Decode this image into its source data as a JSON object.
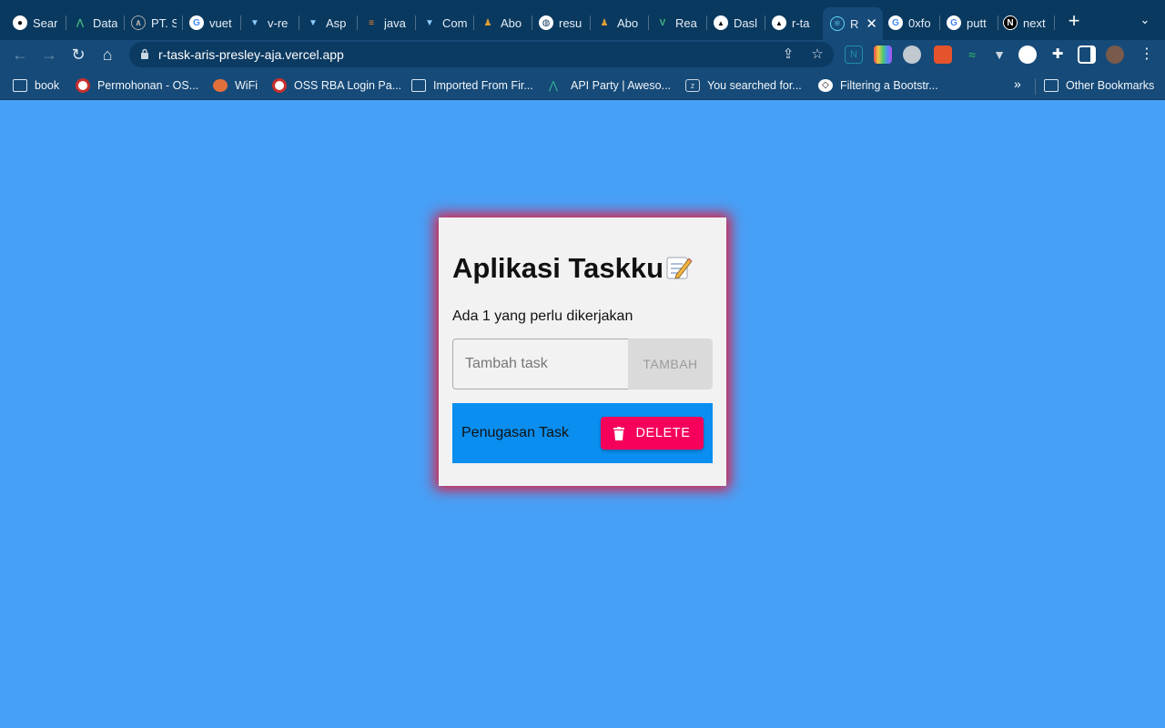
{
  "browser": {
    "tabs": [
      {
        "title": "Sear",
        "icon": "github-icon"
      },
      {
        "title": "Data",
        "icon": "vuetify-icon"
      },
      {
        "title": "PT. S",
        "icon": "site-icon"
      },
      {
        "title": "vuet",
        "icon": "google-icon"
      },
      {
        "title": "v-re",
        "icon": "vuetify-icon"
      },
      {
        "title": "Asp",
        "icon": "vuetify-icon"
      },
      {
        "title": "java",
        "icon": "stackoverflow-icon"
      },
      {
        "title": "Com",
        "icon": "vuetify-icon"
      },
      {
        "title": "Abo",
        "icon": "site-icon"
      },
      {
        "title": "resu",
        "icon": "globe-icon"
      },
      {
        "title": "Abo",
        "icon": "site-icon"
      },
      {
        "title": "Rea",
        "icon": "vue-icon"
      },
      {
        "title": "Dasl",
        "icon": "vercel-icon"
      },
      {
        "title": "r-ta",
        "icon": "vercel-icon"
      },
      {
        "title": "R",
        "icon": "react-icon",
        "active": true
      },
      {
        "title": "0xfo",
        "icon": "google-icon"
      },
      {
        "title": "putt",
        "icon": "google-icon"
      },
      {
        "title": "next",
        "icon": "nextjs-icon"
      }
    ],
    "url": "r-task-aris-presley-aja.vercel.app",
    "bookmarks": [
      {
        "label": "book",
        "icon": "folder-icon"
      },
      {
        "label": "Permohonan - OS...",
        "icon": "oss-icon"
      },
      {
        "label": "WiFi",
        "icon": "wifi-router-icon"
      },
      {
        "label": "OSS RBA Login Pa...",
        "icon": "oss-icon"
      },
      {
        "label": "Imported From Fir...",
        "icon": "folder-icon"
      },
      {
        "label": "API Party | Aweso...",
        "icon": "api-party-icon"
      },
      {
        "label": "You searched for...",
        "icon": "zsearch-icon"
      },
      {
        "label": "Filtering a Bootstr...",
        "icon": "codepen-icon"
      }
    ],
    "other_bookmarks": "Other Bookmarks",
    "more_bookmarks": "»"
  },
  "app": {
    "title": "Aplikasi Taskku",
    "count_text": "Ada 1 yang perlu dikerjakan",
    "input_placeholder": "Tambah task",
    "add_label": "TAMBAH",
    "tasks": [
      {
        "name": "Penugasan Task",
        "delete_label": "DELETE"
      }
    ]
  },
  "colors": {
    "page_background": "#47a0f7",
    "card_background": "#f2f2f2",
    "card_glow": "#e8173a",
    "task_row": "#0a8ef0",
    "delete_button": "#f5005a"
  }
}
